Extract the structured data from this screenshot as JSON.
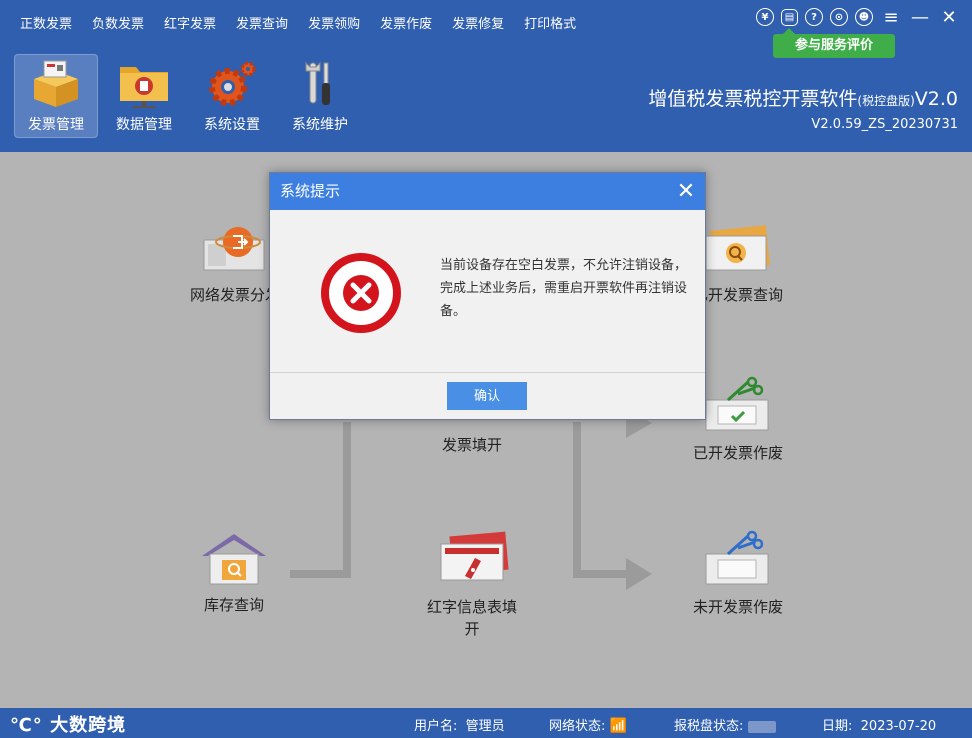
{
  "menu": [
    "正数发票",
    "负数发票",
    "红字发票",
    "发票查询",
    "发票领购",
    "发票作废",
    "发票修复",
    "打印格式"
  ],
  "header": {
    "feedback_label": "参与服务评价",
    "product_name": "增值税发票税控开票软件",
    "product_edition": "(税控盘版)",
    "product_ver_short": "V2.0",
    "version": "V2.0.59_ZS_20230731"
  },
  "tools": [
    {
      "label": "发票管理",
      "icon": "invoice-box-icon",
      "active": true
    },
    {
      "label": "数据管理",
      "icon": "folder-icon",
      "active": false
    },
    {
      "label": "系统设置",
      "icon": "gear-icon",
      "active": false
    },
    {
      "label": "系统维护",
      "icon": "wrench-icon",
      "active": false
    }
  ],
  "workflow": {
    "network_dist": "网络发票分发",
    "issued_query": "已开发票查询",
    "issued_void": "已开发票作废",
    "invoice_fill": "发票填开",
    "stock_query": "库存查询",
    "red_info_fill": "红字信息表填开",
    "unissued_void": "未开发票作废"
  },
  "statusbar": {
    "brand": "大数跨境",
    "user_label": "用户名:",
    "user_value": "管理员",
    "network_label": "网络状态:",
    "tax_disk_label": "报税盘状态:",
    "date_label": "日期:",
    "date_value": "2023-07-20"
  },
  "dialog": {
    "title": "系统提示",
    "message": "当前设备存在空白发票，不允许注销设备，完成上述业务后，需重启开票软件再注销设备。",
    "ok_label": "确认"
  },
  "colors": {
    "header_bg": "#2f5fae",
    "dialog_title_bg": "#3d7fe0",
    "error_red": "#d4141c",
    "feedback_green": "#3fae49"
  }
}
